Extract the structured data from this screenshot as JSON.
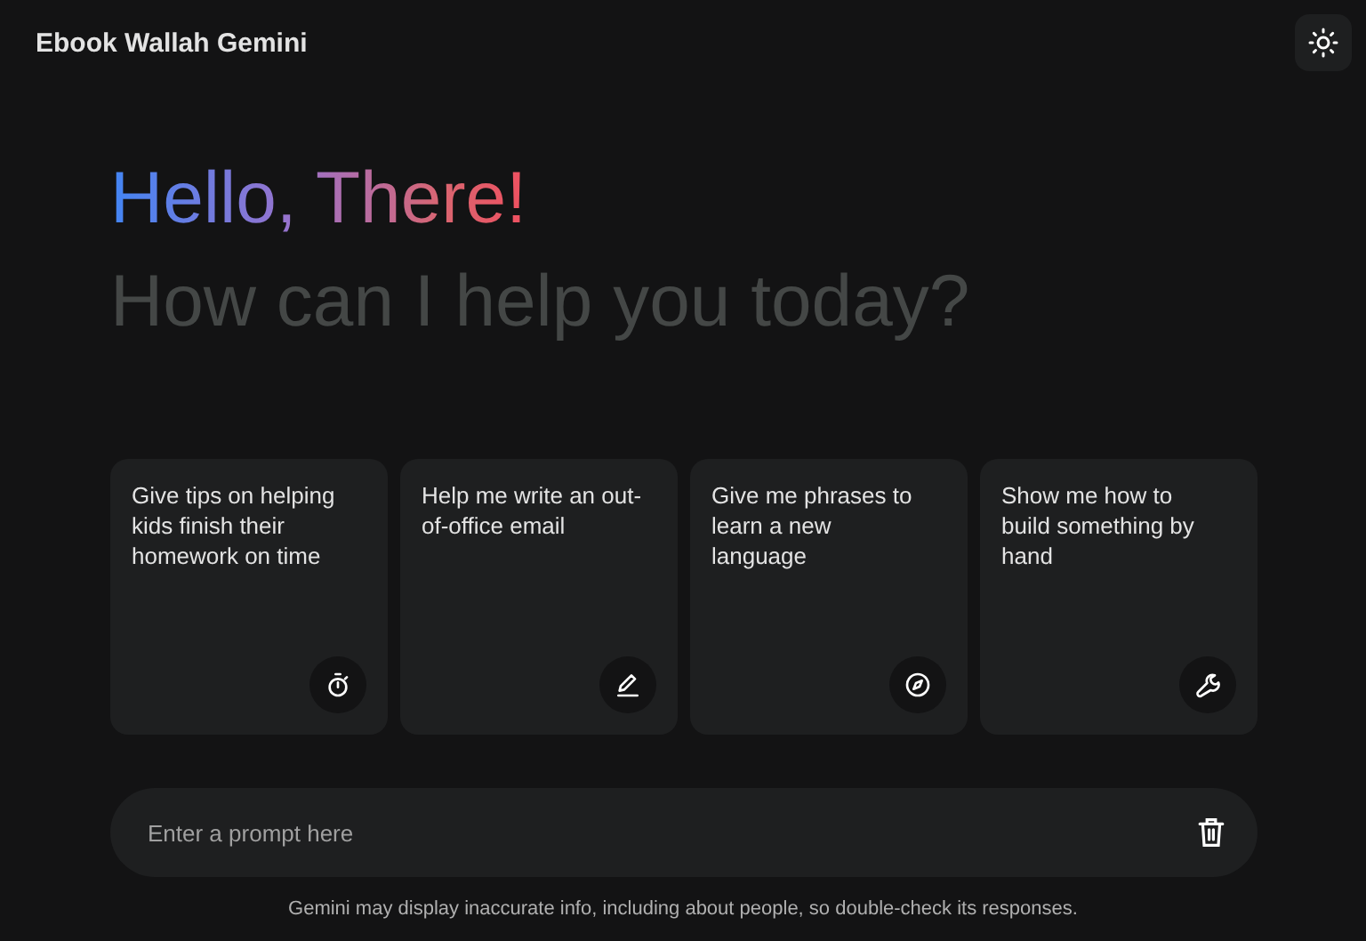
{
  "header": {
    "title": "Ebook Wallah Gemini"
  },
  "greeting": {
    "title": "Hello, There!",
    "subtitle": "How can I help you today?"
  },
  "suggestions": [
    {
      "text": "Give tips on helping kids finish their homework on time",
      "kind": "timer"
    },
    {
      "text": "Help me write an out-of-office email",
      "kind": "pencil"
    },
    {
      "text": "Give me phrases to learn a new language",
      "kind": "compass"
    },
    {
      "text": "Show me how to build something by hand",
      "kind": "wrench"
    }
  ],
  "prompt": {
    "placeholder": "Enter a prompt here"
  },
  "disclaimer": "Gemini may display inaccurate info, including about people, so double-check its responses."
}
